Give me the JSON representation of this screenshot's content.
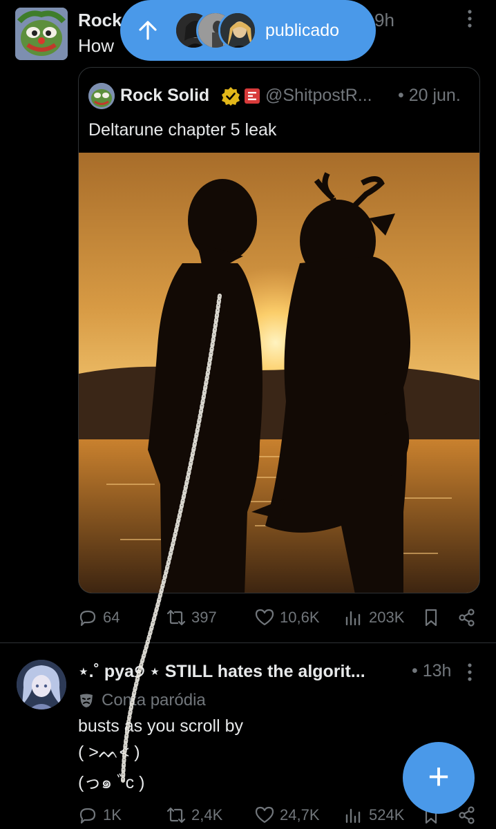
{
  "pill": {
    "label": "publicado"
  },
  "tweet1": {
    "name": "Rock",
    "text": "How",
    "time": "9h",
    "quote": {
      "name": "Rock Solid",
      "handle": "@ShitpostR...",
      "date": "• 20 jun.",
      "text": "Deltarune chapter 5 leak"
    },
    "actions": {
      "replies": "64",
      "reposts": "397",
      "likes": "10,6K",
      "views": "203K"
    }
  },
  "tweet2": {
    "name": "⋆.˚ pya୭ ⋆ STILL hates the algorit...",
    "time": "• 13h",
    "parody_label": "Conta paródia",
    "lines": [
      "busts as you scroll by",
      "( >ᨓ< )",
      "(っ๑ ﾞc )"
    ],
    "actions": {
      "replies": "1K",
      "reposts": "2,4K",
      "likes": "24,7K",
      "views": "524K"
    }
  },
  "colors": {
    "accent": "#4a99e9",
    "muted": "#71767b",
    "text": "#e7e9ea",
    "border": "#2f3336",
    "verified": "#e2b719"
  }
}
